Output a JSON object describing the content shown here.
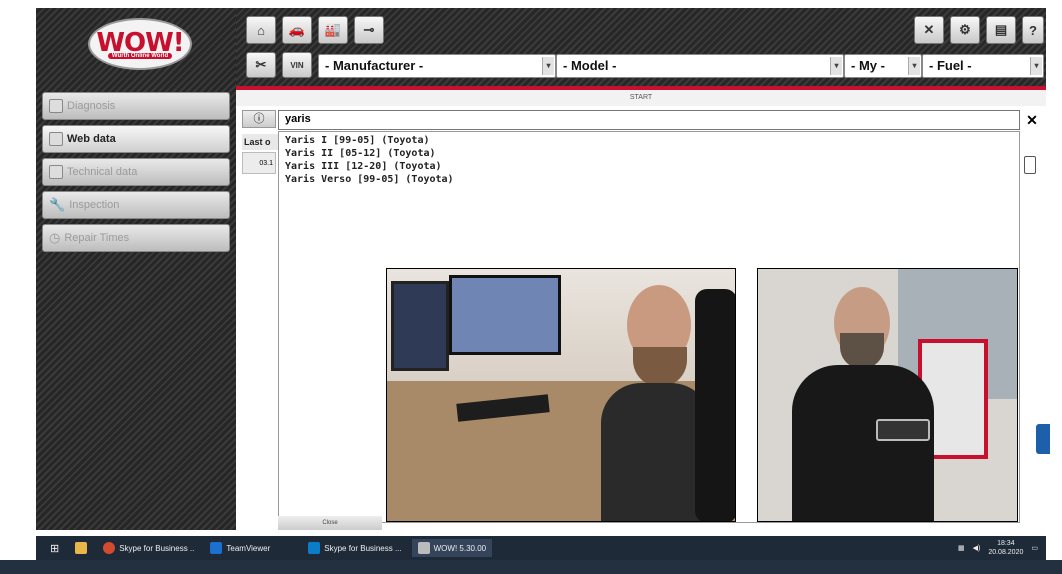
{
  "logo": {
    "text": "WOW!",
    "subtitle": "Würth Online World"
  },
  "toolbar": {
    "vin_label": "VIN",
    "manufacturer": "- Manufacturer -",
    "model": "- Model -",
    "my": "- My -",
    "fuel": "- Fuel -",
    "help_label": "?"
  },
  "sidebar": {
    "items": [
      {
        "label": "Diagnosis",
        "icon": "diagnosis-icon",
        "active": false
      },
      {
        "label": "Web data",
        "icon": "web-data-icon",
        "active": true
      },
      {
        "label": "Technical data",
        "icon": "technical-data-icon",
        "active": false
      },
      {
        "label": "Inspection",
        "icon": "wrench-icon",
        "active": false
      },
      {
        "label": "Repair Times",
        "icon": "clock-icon",
        "active": false
      }
    ]
  },
  "content": {
    "start_label": "START",
    "info_label": "ⓘ",
    "search_value": "yaris",
    "last_label": "Last o",
    "date_cell": "03.1",
    "suggestions": [
      "Yaris I [99-05] (Toyota)",
      "Yaris II [05-12] (Toyota)",
      "Yaris III [12-20] (Toyota)",
      "Yaris Verso [99-05] (Toyota)"
    ],
    "close_label": "Close"
  },
  "taskbar": {
    "apps": [
      {
        "label": "Skype for Business ..",
        "color": "#d24b2e"
      },
      {
        "label": "TeamViewer",
        "color": "#1a6fd1"
      },
      {
        "label": "Skype for Business ...",
        "color": "#0a7cc8"
      },
      {
        "label": "WOW! 5.30.00",
        "color": "#bbbbbb"
      }
    ],
    "time": "18:34",
    "date": "20.08.2020"
  },
  "colors": {
    "accent": "#c8102e",
    "taskbar": "#1f2a38"
  }
}
